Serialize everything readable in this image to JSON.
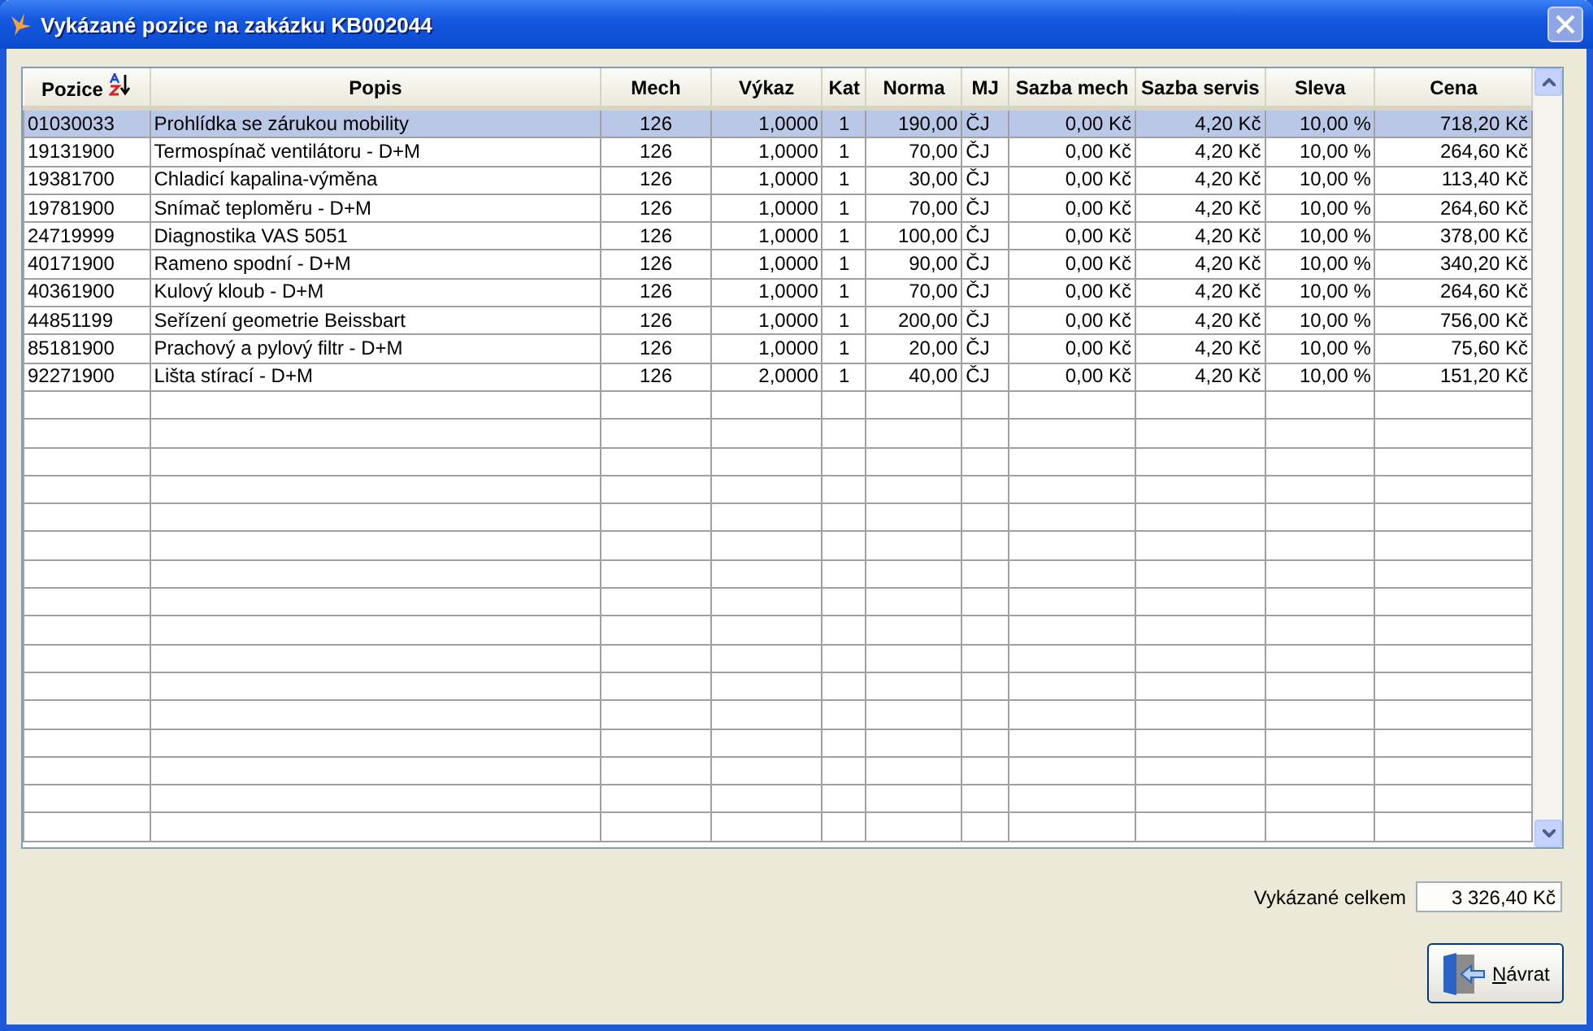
{
  "window": {
    "title": "Vykázané pozice na zakázku KB002044"
  },
  "table": {
    "columns": [
      {
        "label": "Pozice",
        "sorted": true
      },
      {
        "label": "Popis",
        "sorted": false
      },
      {
        "label": "Mech",
        "sorted": false
      },
      {
        "label": "Výkaz",
        "sorted": false
      },
      {
        "label": "Kat",
        "sorted": false
      },
      {
        "label": "Norma",
        "sorted": false
      },
      {
        "label": "MJ",
        "sorted": false
      },
      {
        "label": "Sazba mech",
        "sorted": false
      },
      {
        "label": "Sazba servis",
        "sorted": false
      },
      {
        "label": "Sleva",
        "sorted": false
      },
      {
        "label": "Cena",
        "sorted": false
      }
    ],
    "rows": [
      {
        "selected": true,
        "cells": [
          "01030033",
          "Prohlídka se zárukou mobility",
          "126",
          "1,0000",
          "1",
          "190,00",
          "ČJ",
          "0,00 Kč",
          "4,20 Kč",
          "10,00 %",
          "718,20 Kč"
        ]
      },
      {
        "selected": false,
        "cells": [
          "19131900",
          "Termospínač ventilátoru - D+M",
          "126",
          "1,0000",
          "1",
          "70,00",
          "ČJ",
          "0,00 Kč",
          "4,20 Kč",
          "10,00 %",
          "264,60 Kč"
        ]
      },
      {
        "selected": false,
        "cells": [
          "19381700",
          "Chladicí kapalina-výměna",
          "126",
          "1,0000",
          "1",
          "30,00",
          "ČJ",
          "0,00 Kč",
          "4,20 Kč",
          "10,00 %",
          "113,40 Kč"
        ]
      },
      {
        "selected": false,
        "cells": [
          "19781900",
          "Snímač teploměru - D+M",
          "126",
          "1,0000",
          "1",
          "70,00",
          "ČJ",
          "0,00 Kč",
          "4,20 Kč",
          "10,00 %",
          "264,60 Kč"
        ]
      },
      {
        "selected": false,
        "cells": [
          "24719999",
          "Diagnostika VAS 5051",
          "126",
          "1,0000",
          "1",
          "100,00",
          "ČJ",
          "0,00 Kč",
          "4,20 Kč",
          "10,00 %",
          "378,00 Kč"
        ]
      },
      {
        "selected": false,
        "cells": [
          "40171900",
          "Rameno spodní - D+M",
          "126",
          "1,0000",
          "1",
          "90,00",
          "ČJ",
          "0,00 Kč",
          "4,20 Kč",
          "10,00 %",
          "340,20 Kč"
        ]
      },
      {
        "selected": false,
        "cells": [
          "40361900",
          "Kulový kloub - D+M",
          "126",
          "1,0000",
          "1",
          "70,00",
          "ČJ",
          "0,00 Kč",
          "4,20 Kč",
          "10,00 %",
          "264,60 Kč"
        ]
      },
      {
        "selected": false,
        "cells": [
          "44851199",
          "Seřízení geometrie Beissbart",
          "126",
          "1,0000",
          "1",
          "200,00",
          "ČJ",
          "0,00 Kč",
          "4,20 Kč",
          "10,00 %",
          "756,00 Kč"
        ]
      },
      {
        "selected": false,
        "cells": [
          "85181900",
          "Prachový a pylový filtr - D+M",
          "126",
          "1,0000",
          "1",
          "20,00",
          "ČJ",
          "0,00 Kč",
          "4,20 Kč",
          "10,00 %",
          "75,60 Kč"
        ]
      },
      {
        "selected": false,
        "cells": [
          "92271900",
          "Lišta stírací - D+M",
          "126",
          "2,0000",
          "1",
          "40,00",
          "ČJ",
          "0,00 Kč",
          "4,20 Kč",
          "10,00 %",
          "151,20 Kč"
        ]
      }
    ]
  },
  "total": {
    "label": "Vykázané celkem",
    "value": "3 326,40 Kč"
  },
  "buttons": [
    {
      "label": "Návrat"
    }
  ]
}
